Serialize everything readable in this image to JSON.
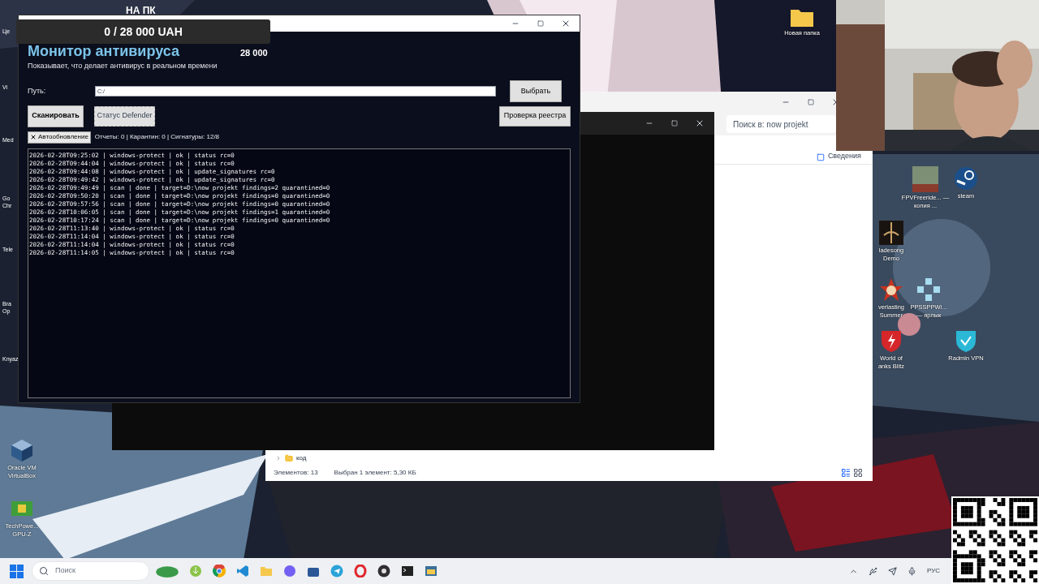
{
  "stream_overlay": {
    "goal": "0 / 28 000 UAH",
    "goal_amount": "28 000",
    "banner": "НА ПК"
  },
  "desktop_icons_left": [
    {
      "label": "Це"
    },
    {
      "label": "Vi"
    },
    {
      "label": "Med"
    },
    {
      "label": "Go Chr"
    },
    {
      "label": "Tele"
    },
    {
      "label": "Bra Op"
    },
    {
      "label": "Knyaz"
    }
  ],
  "desktop_icons_bottom_left": [
    {
      "label": "Oracle VM VirtualBox",
      "kind": "cube"
    },
    {
      "label": "TechPowe... GPU-Z",
      "kind": "chip"
    }
  ],
  "desktop_icons_right": [
    {
      "label": "Новая папка",
      "kind": "folder"
    },
    {
      "label": "FPVFreeride... — копия ...",
      "kind": "game"
    },
    {
      "label": "steam",
      "kind": "steam"
    },
    {
      "label": "ladesong Demo",
      "kind": "sword"
    },
    {
      "label": "verlasting Summer",
      "kind": "star"
    },
    {
      "label": "PPSSPPWi... — ярлык",
      "kind": "psp"
    },
    {
      "label": "World of anks Blitz",
      "kind": "shield"
    },
    {
      "label": "Radmin VPN",
      "kind": "vpn"
    }
  ],
  "explorer": {
    "search_placeholder": "Поиск в: now projekt",
    "details": "Сведения",
    "tree_item": "код",
    "status_items": "Элементов: 13",
    "status_selected": "Выбран 1 элемент: 5,30 КБ"
  },
  "monitor": {
    "title": "Монитор антивируса",
    "subtitle": "Показывает, что делает антивирус в реальном времени",
    "path_label": "Путь:",
    "path_value": "C:/",
    "browse": "Выбрать",
    "scan": "Сканировать",
    "defender": "Статус Defender",
    "registry": "Проверка реестра",
    "auto_update": {
      "label": "Автообновление",
      "checked": true
    },
    "stats": "Отчеты: 0 | Карантин: 0 | Сигнатуры: 12/8",
    "log": [
      "2026-02-28T09:25:02 | windows-protect | ok | status rc=0",
      "2026-02-28T09:44:04 | windows-protect | ok | status rc=0",
      "2026-02-28T09:44:08 | windows-protect | ok | update_signatures rc=0",
      "2026-02-28T09:49:42 | windows-protect | ok | update_signatures rc=0",
      "2026-02-28T09:49:49 | scan | done | target=D:\\now projekt findings=2 quarantined=0",
      "2026-02-28T09:50:20 | scan | done | target=D:\\now projekt findings=0 quarantined=0",
      "2026-02-28T09:57:56 | scan | done | target=D:\\now projekt findings=0 quarantined=0",
      "2026-02-28T10:06:05 | scan | done | target=D:\\now projekt findings=1 quarantined=0",
      "2026-02-28T10:17:24 | scan | done | target=D:\\now projekt findings=0 quarantined=0",
      "2026-02-28T11:13:40 | windows-protect | ok | status rc=0",
      "2026-02-28T11:14:04 | windows-protect | ok | status rc=0",
      "2026-02-28T11:14:04 | windows-protect | ok | status rc=0",
      "2026-02-28T11:14:05 | windows-protect | ok | status rc=0"
    ]
  },
  "taskbar": {
    "search_placeholder": "Поиск",
    "language": "РУС"
  }
}
